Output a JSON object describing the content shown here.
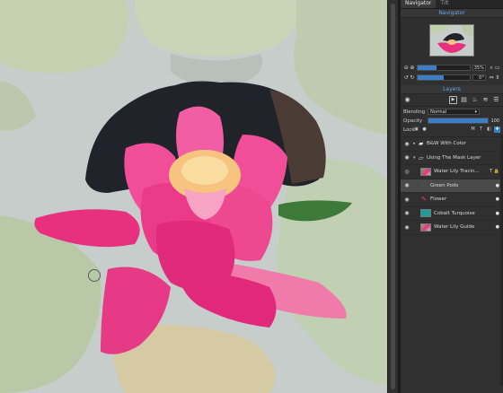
{
  "panel": {
    "tabs": [
      {
        "label": "Navigator",
        "active": true
      },
      {
        "label": "Tilt",
        "active": false
      }
    ],
    "navigator": {
      "title": "Navigator",
      "zoom_value": "35%",
      "rotation_value": "0°",
      "zoom_level": 0.36,
      "rotation_level": 0.5
    },
    "layers": {
      "title": "Layers",
      "blending_label": "Blending",
      "blending_value": "Normal",
      "opacity_label": "Opacity",
      "opacity_value": "100",
      "opacity_level": 1.0,
      "lock_label": "Lock",
      "items": [
        {
          "name": "B&W With Color",
          "type": "group",
          "depth": 0
        },
        {
          "name": "Using The Mask Layer",
          "type": "group",
          "depth": 0
        },
        {
          "name": "Water Lily Tracin...",
          "type": "tracing",
          "depth": 1
        },
        {
          "name": "Green Pods",
          "type": "paint",
          "depth": 1,
          "selected": true
        },
        {
          "name": "Flower",
          "type": "paint",
          "depth": 1
        },
        {
          "name": "Cobalt Turquoise",
          "type": "fill",
          "depth": 1
        },
        {
          "name": "Water Lily Guide",
          "type": "image",
          "depth": 1
        }
      ]
    }
  },
  "colors": {
    "accent": "#3a7fc7",
    "navigator_title": "#6aa6e8",
    "flower_pink": "#e62a86",
    "cobalt_turquoise": "#1e9c9a"
  }
}
